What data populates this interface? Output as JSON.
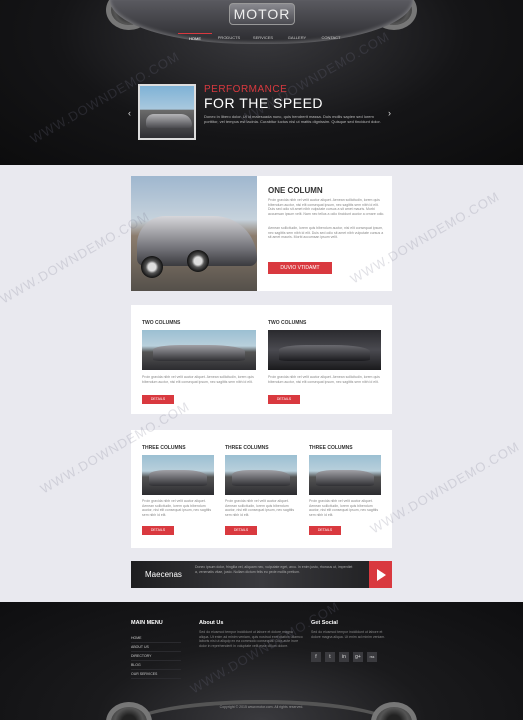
{
  "header": {
    "logo": "MOTOR",
    "nav": [
      "HOME",
      "PRODUCTS",
      "SERVICES",
      "GALLERY",
      "CONTACT"
    ],
    "slide_kicker": "PERFORMANCE",
    "slide_title": "FOR THE SPEED",
    "slide_text": "Donec in libero dolor. Ut id malesuada nunc, quis hendrerit massa. Duis mollis sapien sed lorem porttitor, vel tempus est lacinia. Curabitur luctus nisl ut mattis dignissim. Quisque sed tincidunt dolor."
  },
  "one_column": {
    "title": "ONE COLUMN",
    "text1": "Proin gravida nibh vel velit auctor aliquet. Aenean sollicitudin, lorem quis bibendum auctor, nisi elit consequat ipsum, nec sagittis sem nibh id elit. Duis sed odio sit amet nibh vulputate cursus a sit amet mauris. Morbi accumsan ipsum velit. Nam nec tellus a odio tincidunt auctor a ornare odio.",
    "text2": "Aenean sollicitudin, lorem quis bibendum auctor, nisi elit consequat ipsum, nec sagittis sem nibh id elit. Duis sed odio sit amet nibh vulputate cursus a sit amet mauris. Morbi accumsan ipsum velit.",
    "button": "DUVIO VTIDAMT"
  },
  "two_columns": [
    {
      "title": "TWO COLUMNS",
      "text": "Proin gravida nibh vel velit auctor aliquet. Aenean sollicitudin, lorem quis bibendum auctor, nisi elit consequat ipsum, nec sagittis sem nibh id elit.",
      "button": "DETAILS"
    },
    {
      "title": "TWO COLUMNS",
      "text": "Proin gravida nibh vel velit auctor aliquet. Aenean sollicitudin, lorem quis bibendum auctor, nisi elit consequat ipsum, nec sagittis sem nibh id elit.",
      "button": "DETAILS"
    }
  ],
  "three_columns": [
    {
      "title": "THREE COLUMNS",
      "text": "Proin gravida nibh vel velit auctor aliquet. Aenean sollicitudin, lorem quis bibendum auctor, nisi elit consequat ipsum, nec sagittis sem nibh id elit.",
      "button": "DETAILS"
    },
    {
      "title": "THREE COLUMNS",
      "text": "Proin gravida nibh vel velit auctor aliquet. Aenean sollicitudin, lorem quis bibendum auctor, nisi elit consequat ipsum, nec sagittis sem nibh id elit.",
      "button": "DETAILS"
    },
    {
      "title": "THREE COLUMNS",
      "text": "Proin gravida nibh vel velit auctor aliquet. Aenean sollicitudin, lorem quis bibendum auctor, nisi elit consequat ipsum, nec sagittis sem nibh id elit.",
      "button": "DETAILS"
    }
  ],
  "banner": {
    "title": "Maecenas",
    "text": "Donec ipsum dolor, fringilla vel, aliquam nec, vulputate eget, arcu. In enim justo, rhoncus ut, imperdiet a, venenatis vitae, justo. Nullam dictum felis eu pede mollis pretium."
  },
  "footer": {
    "menu_title": "MAIN MENU",
    "menu": [
      "HOME",
      "ABOUT US",
      "DIRECTORY",
      "BLOG",
      "OUR SERVICES"
    ],
    "about_title": "About Us",
    "about_text": "Sed do eiusmod tempor incididunt ut labore et dolore magna aliqua. Ut enim ad minim veniam, quis nostrud exercitation ullamco laboris nisi ut aliquip ex ea commodo consequat. Duis aute irure dolor in reprehenderit in voluptate velit esse cillum dolore.",
    "social_title": "Get Social",
    "social_text": "Sed do eiusmod tempor incididunt ut labore et dolore magna aliqua. Ut enim ad minim veniam.",
    "social_icons": [
      "f",
      "t",
      "in",
      "g+",
      "rss"
    ],
    "copyright": "Copyright © 2015 www.motor.com. All rights reserved."
  },
  "watermark": "WWW.DOWNDEMO.COM",
  "colors": {
    "accent": "#d9393f",
    "dark": "#151517",
    "page_bg": "#e9e9ef"
  }
}
